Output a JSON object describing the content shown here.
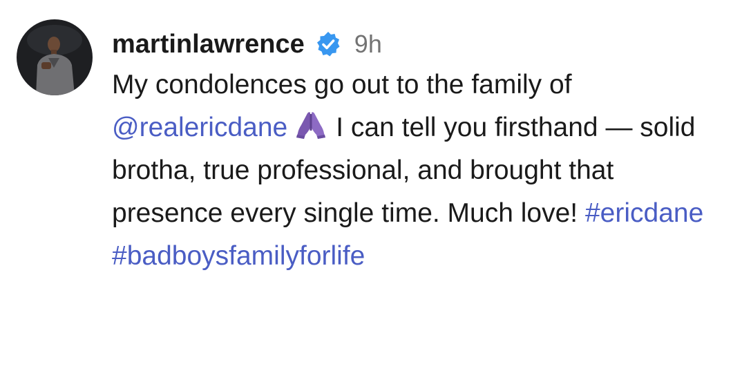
{
  "post": {
    "username": "martinlawrence",
    "time": "9h",
    "verified_icon": "verified-badge-icon",
    "emoji_icon": "folded-hands-emoji",
    "caption": {
      "part1": "My condolences go out to the family of ",
      "mention": "@realericdane",
      "part2": "I can tell you firsthand — solid brotha, true professional, and brought that presence every single time. Much love! ",
      "hashtag1": "#ericdane",
      "hashtag2": "#badboysfamilyforlife"
    },
    "colors": {
      "link": "#4a5dc4",
      "verified": "#3897f0",
      "time": "#737373",
      "text": "#1a1a1a"
    }
  }
}
